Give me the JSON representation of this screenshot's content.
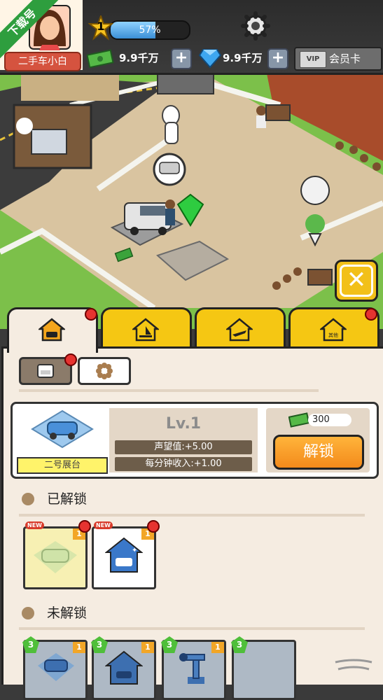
{
  "hud": {
    "player_name": "二手车小白",
    "download_ribbon": "下载号",
    "level": "1",
    "xp_percent": 57,
    "xp_label": "57%",
    "cash": "9.9千万",
    "gems": "9.9千万",
    "vip_card_text": "VIP",
    "vip_label": "会员卡"
  },
  "tabs": [
    {
      "name": "showroom",
      "active": true,
      "dot": true
    },
    {
      "name": "boat",
      "active": false,
      "dot": false
    },
    {
      "name": "plane",
      "active": false,
      "dot": false
    },
    {
      "name": "other",
      "label": "其他",
      "active": false,
      "dot": true
    }
  ],
  "panel": {
    "booth": {
      "name": "二号展台",
      "level": "Lv.1",
      "reputation": "声望值:+5.00",
      "income": "每分钟收入:+1.00",
      "cost": "300",
      "unlock_label": "解锁"
    },
    "unlocked_title": "已解锁",
    "unlocked_items": [
      {
        "icon": "car-icon",
        "count": "1",
        "new_tag": "NEW"
      },
      {
        "icon": "car-wash-icon",
        "count": "1",
        "new_tag": "NEW"
      }
    ],
    "locked_title": "未解锁",
    "locked_items": [
      {
        "icon": "car-icon",
        "level": "3",
        "count": "1"
      },
      {
        "icon": "garage-icon",
        "level": "3",
        "count": "1"
      },
      {
        "icon": "robot-arm-icon",
        "level": "3",
        "count": "1"
      },
      {
        "icon": "item-icon",
        "level": "3",
        "count": ""
      }
    ]
  },
  "watermark": "—"
}
